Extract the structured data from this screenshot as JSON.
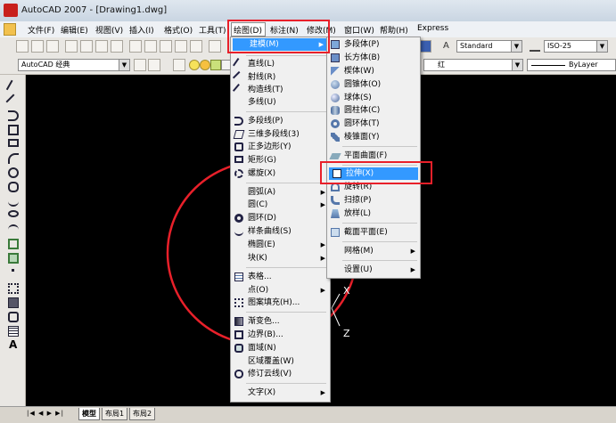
{
  "window": {
    "title": "AutoCAD 2007 - [Drawing1.dwg]"
  },
  "menubar": {
    "items": [
      {
        "label": "文件(F)"
      },
      {
        "label": "编辑(E)"
      },
      {
        "label": "视图(V)"
      },
      {
        "label": "插入(I)"
      },
      {
        "label": "格式(O)"
      },
      {
        "label": "工具(T)"
      },
      {
        "label": "绘图(D)"
      },
      {
        "label": "标注(N)"
      },
      {
        "label": "修改(M)"
      },
      {
        "label": "窗口(W)"
      },
      {
        "label": "帮助(H)"
      },
      {
        "label": "Express"
      }
    ]
  },
  "toolbar": {
    "workspace": "AutoCAD 经典",
    "text_style": "Standard",
    "dim_style": "ISO-25",
    "color": "红",
    "linetype": "ByLayer"
  },
  "draw_menu": {
    "items": [
      {
        "label": "建模(M)",
        "icon": "modeling-icon",
        "submenu": true
      },
      {
        "label": "直线(L)",
        "icon": "line-icon"
      },
      {
        "label": "射线(R)",
        "icon": "ray-icon"
      },
      {
        "label": "构造线(T)",
        "icon": "construction-line-icon"
      },
      {
        "label": "多线(U)",
        "icon": ""
      },
      {
        "label": "多段线(P)",
        "icon": "polyline-icon"
      },
      {
        "label": "三维多段线(3)",
        "icon": "3d-polyline-icon"
      },
      {
        "label": "正多边形(Y)",
        "icon": "polygon-icon"
      },
      {
        "label": "矩形(G)",
        "icon": "rectangle-icon"
      },
      {
        "label": "螺旋(X)",
        "icon": "helix-icon"
      },
      {
        "label": "圆弧(A)",
        "icon": "",
        "submenu": true
      },
      {
        "label": "圆(C)",
        "icon": "",
        "submenu": true
      },
      {
        "label": "圆环(D)",
        "icon": "donut-icon"
      },
      {
        "label": "样条曲线(S)",
        "icon": "spline-icon"
      },
      {
        "label": "椭圆(E)",
        "icon": "",
        "submenu": true
      },
      {
        "label": "块(K)",
        "icon": "",
        "submenu": true
      },
      {
        "label": "表格...",
        "icon": "table-icon"
      },
      {
        "label": "点(O)",
        "icon": "",
        "submenu": true
      },
      {
        "label": "图案填充(H)...",
        "icon": "hatch-icon"
      },
      {
        "label": "渐变色...",
        "icon": "gradient-icon"
      },
      {
        "label": "边界(B)...",
        "icon": "boundary-icon"
      },
      {
        "label": "面域(N)",
        "icon": "region-icon"
      },
      {
        "label": "区域覆盖(W)",
        "icon": ""
      },
      {
        "label": "修订云线(V)",
        "icon": "revision-cloud-icon"
      },
      {
        "label": "文字(X)",
        "icon": "",
        "submenu": true
      }
    ]
  },
  "modeling_menu": {
    "items": [
      {
        "label": "多段体(P)",
        "icon": "polysolid-icon"
      },
      {
        "label": "长方体(B)",
        "icon": "box-icon"
      },
      {
        "label": "楔体(W)",
        "icon": "wedge-icon"
      },
      {
        "label": "圆锥体(O)",
        "icon": "cone-icon"
      },
      {
        "label": "球体(S)",
        "icon": "sphere-icon"
      },
      {
        "label": "圆柱体(C)",
        "icon": "cylinder-icon"
      },
      {
        "label": "圆环体(T)",
        "icon": "torus-icon"
      },
      {
        "label": "棱锥面(Y)",
        "icon": "pyramid-icon"
      },
      {
        "label": "平面曲面(F)",
        "icon": "planar-surface-icon"
      },
      {
        "label": "拉伸(X)",
        "icon": "extrude-icon"
      },
      {
        "label": "旋转(R)",
        "icon": "revolve-icon"
      },
      {
        "label": "扫掠(P)",
        "icon": "sweep-icon"
      },
      {
        "label": "放样(L)",
        "icon": "loft-icon"
      },
      {
        "label": "截面平面(E)",
        "icon": "section-plane-icon"
      },
      {
        "label": "网格(M)",
        "icon": "",
        "submenu": true
      },
      {
        "label": "设置(U)",
        "icon": "",
        "submenu": true
      }
    ]
  },
  "canvas": {
    "ucs_x": "X",
    "ucs_z": "Z"
  },
  "tabs": [
    "模型",
    "布局1",
    "布局2"
  ],
  "colors": {
    "highlight": "#3399ff",
    "annotation": "#e8202a",
    "canvas": "#000000"
  }
}
